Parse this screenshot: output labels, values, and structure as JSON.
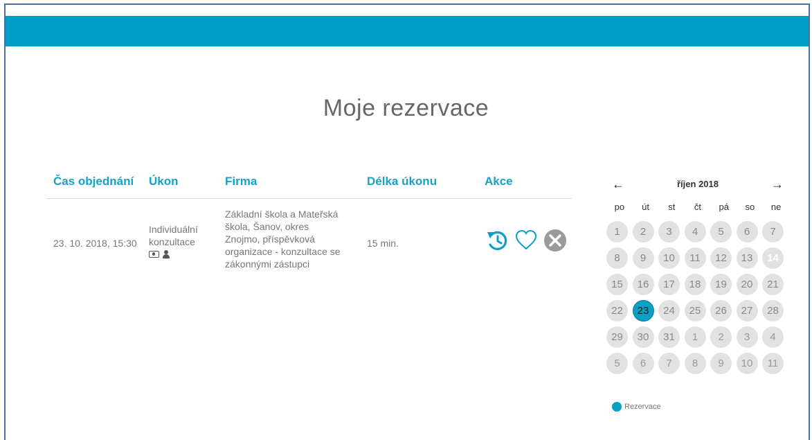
{
  "page": {
    "title": "Moje rezervace"
  },
  "table": {
    "headers": [
      "Čas objednání",
      "Úkon",
      "Firma",
      "Délka úkonu",
      "Akce"
    ],
    "rows": [
      {
        "time": "23. 10. 2018, 15:30",
        "service_line1": "Individuální",
        "service_line2": "konzultace",
        "service_icons": [
          "money-icon",
          "person-icon"
        ],
        "firm_lines": [
          "Základní škola a Mateřská",
          "škola, Šanov, okres",
          "Znojmo, příspěvková",
          "organizace - konzultace se",
          "zákonnými zástupci"
        ],
        "length": "15 min.",
        "actions": [
          "reschedule-icon",
          "favorite-icon",
          "cancel-icon"
        ]
      }
    ]
  },
  "calendar": {
    "prev_label": "←",
    "next_label": "→",
    "month": "říjen 2018",
    "weekdays": [
      "po",
      "út",
      "st",
      "čt",
      "pá",
      "so",
      "ne"
    ],
    "weeks": [
      [
        "1",
        "2",
        "3",
        "4",
        "5",
        "6",
        "7"
      ],
      [
        "8",
        "9",
        "10",
        "11",
        "12",
        "13",
        "14"
      ],
      [
        "15",
        "16",
        "17",
        "18",
        "19",
        "20",
        "21"
      ],
      [
        "22",
        "23",
        "24",
        "25",
        "26",
        "27",
        "28"
      ],
      [
        "29",
        "30",
        "31",
        "1",
        "2",
        "3",
        "4"
      ],
      [
        "5",
        "6",
        "7",
        "8",
        "9",
        "10",
        "11"
      ]
    ],
    "today": "14",
    "selected": "23"
  },
  "legend": {
    "label": "Rezervace",
    "color": "#0a9fc3"
  },
  "colors": {
    "accent": "#009ec6",
    "header_text": "#16a1c7"
  }
}
